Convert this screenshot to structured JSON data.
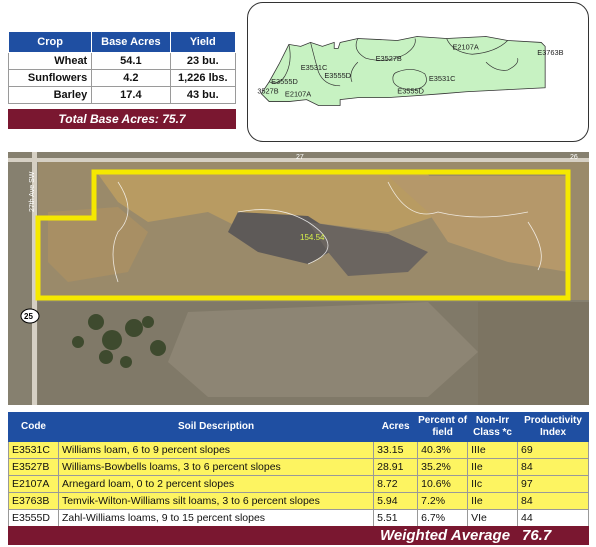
{
  "crop_table": {
    "headers": [
      "Crop",
      "Base Acres",
      "Yield"
    ],
    "rows": [
      {
        "crop": "Wheat",
        "base_acres": "54.1",
        "yield": "23 bu."
      },
      {
        "crop": "Sunflowers",
        "base_acres": "4.2",
        "yield": "1,226 lbs."
      },
      {
        "crop": "Barley",
        "base_acres": "17.4",
        "yield": "43 bu."
      }
    ],
    "total_label": "Total Base Acres:",
    "total_value": "75.7"
  },
  "soil_map": {
    "labels": [
      "E2107A",
      "E3763B",
      "E3527B",
      "E3531C",
      "E3531C",
      "E3555D",
      "E3555D",
      "E3555D",
      "3527B",
      "E2107A"
    ],
    "fill_color": "#c7f2c2"
  },
  "aerial": {
    "road_labels": [
      "27",
      "26",
      "27th Ave SW"
    ],
    "highway_shield": "25",
    "field_acres": "154.54",
    "boundary_color": "#f5e800"
  },
  "soil_table": {
    "headers": [
      "Code",
      "Soil Description",
      "Acres",
      "Percent of field",
      "Non-Irr Class *c",
      "Productivity Index"
    ],
    "rows": [
      {
        "code": "E3531C",
        "description": "Williams loam, 6 to 9 percent slopes",
        "acres": "33.15",
        "percent": "40.3%",
        "class": "IIIe",
        "index": "69",
        "highlight": true
      },
      {
        "code": "E3527B",
        "description": "Williams-Bowbells loams, 3 to 6 percent slopes",
        "acres": "28.91",
        "percent": "35.2%",
        "class": "IIe",
        "index": "84",
        "highlight": true
      },
      {
        "code": "E2107A",
        "description": "Arnegard loam, 0 to 2 percent slopes",
        "acres": "8.72",
        "percent": "10.6%",
        "class": "IIc",
        "index": "97",
        "highlight": true
      },
      {
        "code": "E3763B",
        "description": "Temvik-Wilton-Williams silt loams, 3 to 6 percent slopes",
        "acres": "5.94",
        "percent": "7.2%",
        "class": "IIe",
        "index": "84",
        "highlight": true
      },
      {
        "code": "E3555D",
        "description": "Zahl-Williams loams, 9 to 15 percent slopes",
        "acres": "5.51",
        "percent": "6.7%",
        "class": "VIe",
        "index": "44",
        "highlight": false
      }
    ],
    "weighted_label": "Weighted Average",
    "weighted_value": "76.7"
  },
  "colors": {
    "header_blue": "#1f4fa2",
    "total_maroon": "#7a1730",
    "row_yellow": "#fdf461"
  }
}
